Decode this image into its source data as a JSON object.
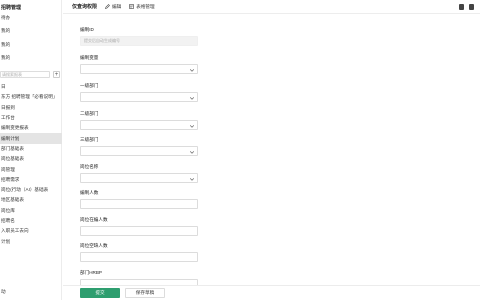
{
  "sidebar": {
    "top_items": [
      "招聘管理",
      "待办",
      "我的",
      "我的",
      "我的"
    ],
    "search_placeholder": "请搜索报表",
    "add_symbol": "+",
    "items": [
      "日",
      "东方 招聘管理「必看说明」",
      "日报到",
      "工作台",
      "编制变更报表",
      "编制计划",
      "部门基础表",
      "岗位基础表",
      "岗管理",
      "招聘需求",
      "岗位(行动（AI）基础表",
      "地区基础表",
      "岗位库",
      "招聘名",
      "入职员工去向",
      "计划"
    ],
    "active_index": 5,
    "footer": "动"
  },
  "header": {
    "title": "仅查询权限",
    "edit_label": "编辑",
    "manage_label": "表格管理"
  },
  "form": {
    "fields": [
      {
        "label": "编制ID",
        "type": "text",
        "disabled": true,
        "placeholder": "提交后自动生成编号"
      },
      {
        "label": "编制变量",
        "type": "select"
      },
      {
        "label": "一级部门",
        "type": "select"
      },
      {
        "label": "二级部门",
        "type": "select"
      },
      {
        "label": "三级部门",
        "type": "select"
      },
      {
        "label": "岗位名称",
        "type": "select"
      },
      {
        "label": "编制人数",
        "type": "text"
      },
      {
        "label": "岗位在编人数",
        "type": "text"
      },
      {
        "label": "岗位空缺人数",
        "type": "text"
      },
      {
        "label": "部门HRBP",
        "type": "text"
      }
    ]
  },
  "footer": {
    "submit_label": "提交",
    "draft_label": "保存草稿"
  },
  "colors": {
    "accent": "#2e9e6f",
    "active_item_bg": "#e4e4e4"
  }
}
